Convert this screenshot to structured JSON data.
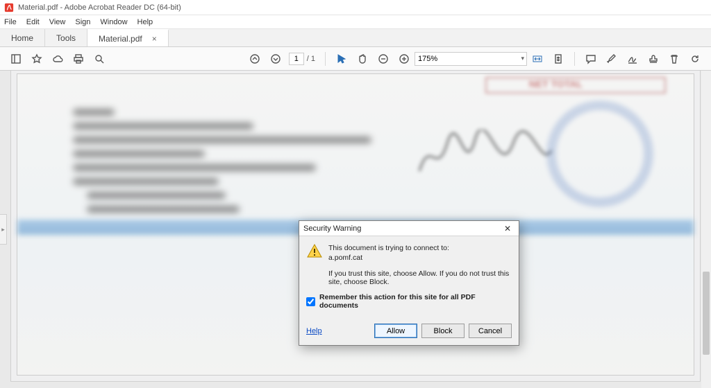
{
  "window": {
    "title": "Material.pdf - Adobe Acrobat Reader DC (64-bit)"
  },
  "menu": {
    "items": [
      "File",
      "Edit",
      "View",
      "Sign",
      "Window",
      "Help"
    ]
  },
  "tabs": {
    "home": "Home",
    "tools": "Tools",
    "doc": "Material.pdf"
  },
  "toolbar": {
    "page_current": "1",
    "page_sep": "/",
    "page_total": "1",
    "zoom": "175%"
  },
  "doc": {
    "stamp_label": "NET TOTAL"
  },
  "dialog": {
    "title": "Security Warning",
    "line1": "This document is trying to connect to:",
    "site": "a.pomf.cat",
    "trust": "If you trust this site, choose Allow. If you do not trust this site, choose Block.",
    "remember": "Remember this action for this site for all PDF documents",
    "remember_checked": true,
    "help": "Help",
    "allow": "Allow",
    "block": "Block",
    "cancel": "Cancel"
  }
}
